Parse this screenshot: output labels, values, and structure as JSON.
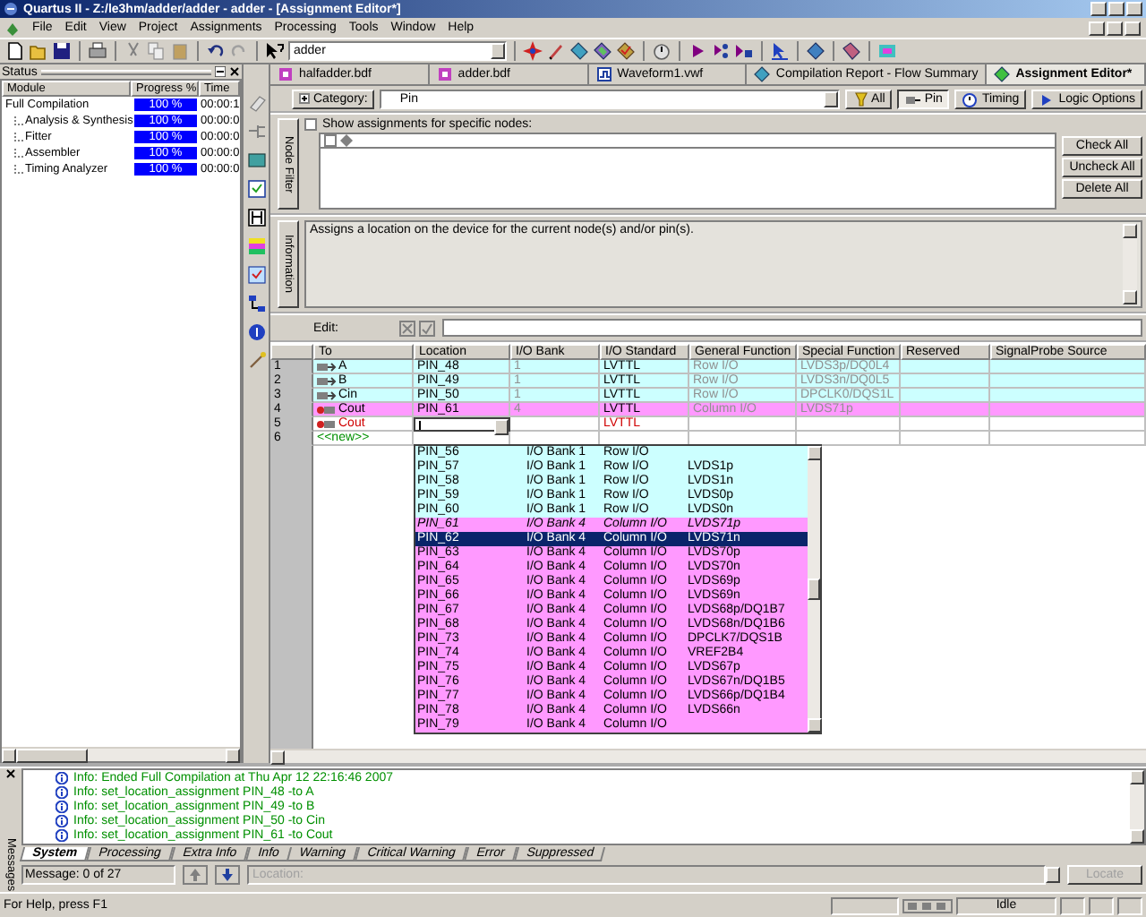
{
  "window": {
    "title": "Quartus II - Z:/le3hm/adder/adder - adder - [Assignment Editor*]"
  },
  "menu": [
    "File",
    "Edit",
    "View",
    "Project",
    "Assignments",
    "Processing",
    "Tools",
    "Window",
    "Help"
  ],
  "toolbar": {
    "project": "adder"
  },
  "status_panel": {
    "title": "Status",
    "columns": [
      "Module",
      "Progress %",
      "Time"
    ],
    "rows": [
      {
        "module": "Full Compilation",
        "level": 1,
        "progress": "100 %",
        "time": "00:00:1",
        "children": [
          {
            "module": "Analysis & Synthesis",
            "level": 1,
            "progress": "100 %",
            "time": "00:00:0"
          },
          {
            "module": "Fitter",
            "level": 1,
            "progress": "100 %",
            "time": "00:00:0"
          },
          {
            "module": "Assembler",
            "level": 1,
            "progress": "100 %",
            "time": "00:00:0"
          },
          {
            "module": "Timing Analyzer",
            "level": 1,
            "progress": "100 %",
            "time": "00:00:0"
          }
        ]
      }
    ]
  },
  "document_tabs": [
    {
      "label": "halfadder.bdf",
      "selected": false
    },
    {
      "label": "adder.bdf",
      "selected": false
    },
    {
      "label": "Waveform1.vwf",
      "selected": false
    },
    {
      "label": "Compilation Report - Flow Summary",
      "selected": false
    },
    {
      "label": "Assignment Editor*",
      "selected": true
    }
  ],
  "category": {
    "label": "Category:",
    "value": "Pin",
    "buttons": [
      {
        "label": "All",
        "selected": false
      },
      {
        "label": "Pin",
        "selected": true
      },
      {
        "label": "Timing",
        "selected": false
      },
      {
        "label": "Logic Options",
        "selected": false
      }
    ]
  },
  "node_filter": {
    "side_label": "Node Filter",
    "checkbox": {
      "label": "Show assignments for specific nodes:",
      "checked": false
    },
    "node_row": {
      "checked": false
    },
    "buttons": [
      "Check All",
      "Uncheck All",
      "Delete All"
    ]
  },
  "information": {
    "side_label": "Information",
    "text": "Assigns a location on the device for the current node(s) and/or pin(s)."
  },
  "edit_bar": {
    "label": "Edit:"
  },
  "table": {
    "columns": [
      "To",
      "Location",
      "I/O Bank",
      "I/O Standard",
      "General Function",
      "Special Function",
      "Reserved",
      "SignalProbe Source"
    ],
    "rows": [
      {
        "kind": "assigned",
        "num": "1",
        "is_output": false,
        "to": "A",
        "location": "PIN_48",
        "io_bank": "1",
        "io_standard": "LVTTL",
        "general_function": "Row I/O",
        "special_function": "LVDS3p/DQ0L4",
        "color": "#ccffff"
      },
      {
        "kind": "assigned",
        "num": "2",
        "is_output": false,
        "to": "B",
        "location": "PIN_49",
        "io_bank": "1",
        "io_standard": "LVTTL",
        "general_function": "Row I/O",
        "special_function": "LVDS3n/DQ0L5",
        "color": "#ccffff"
      },
      {
        "kind": "assigned",
        "num": "3",
        "is_output": false,
        "to": "Cin",
        "location": "PIN_50",
        "io_bank": "1",
        "io_standard": "LVTTL",
        "general_function": "Row I/O",
        "special_function": "DPCLK0/DQS1L",
        "color": "#ccffff"
      },
      {
        "kind": "assigned",
        "num": "4",
        "is_output": true,
        "to": "Cout",
        "location": "PIN_61",
        "io_bank": "4",
        "io_standard": "LVTTL",
        "general_function": "Column I/O",
        "special_function": "LVDS71p",
        "color": "#ff99ff"
      },
      {
        "kind": "editing",
        "num": "5",
        "is_output": true,
        "to": "Cout",
        "io_standard": "LVTTL"
      },
      {
        "kind": "new",
        "num": "6",
        "to": "<<new>>"
      }
    ],
    "dropdown": [
      {
        "location": "PIN_56",
        "io_bank": "I/O Bank 1",
        "general_function": "Row I/O",
        "color": "#ccffff",
        "selected": false,
        "assigned": false
      },
      {
        "location": "PIN_57",
        "io_bank": "I/O Bank 1",
        "general_function": "Row I/O",
        "special_function": "LVDS1p",
        "color": "#ccffff",
        "selected": false,
        "assigned": false
      },
      {
        "location": "PIN_58",
        "io_bank": "I/O Bank 1",
        "general_function": "Row I/O",
        "special_function": "LVDS1n",
        "color": "#ccffff",
        "selected": false,
        "assigned": false
      },
      {
        "location": "PIN_59",
        "io_bank": "I/O Bank 1",
        "general_function": "Row I/O",
        "special_function": "LVDS0p",
        "color": "#ccffff",
        "selected": false,
        "assigned": false
      },
      {
        "location": "PIN_60",
        "io_bank": "I/O Bank 1",
        "general_function": "Row I/O",
        "special_function": "LVDS0n",
        "color": "#ccffff",
        "selected": false,
        "assigned": false
      },
      {
        "location": "PIN_61",
        "io_bank": "I/O Bank 4",
        "general_function": "Column I/O",
        "special_function": "LVDS71p",
        "color": "#ff99ff",
        "selected": false,
        "assigned": true
      },
      {
        "location": "PIN_62",
        "io_bank": "I/O Bank 4",
        "general_function": "Column I/O",
        "special_function": "LVDS71n",
        "selected": true,
        "assigned": false
      },
      {
        "location": "PIN_63",
        "io_bank": "I/O Bank 4",
        "general_function": "Column I/O",
        "special_function": "LVDS70p",
        "color": "#ff99ff",
        "selected": false,
        "assigned": false
      },
      {
        "location": "PIN_64",
        "io_bank": "I/O Bank 4",
        "general_function": "Column I/O",
        "special_function": "LVDS70n",
        "color": "#ff99ff",
        "selected": false,
        "assigned": false
      },
      {
        "location": "PIN_65",
        "io_bank": "I/O Bank 4",
        "general_function": "Column I/O",
        "special_function": "LVDS69p",
        "color": "#ff99ff",
        "selected": false,
        "assigned": false
      },
      {
        "location": "PIN_66",
        "io_bank": "I/O Bank 4",
        "general_function": "Column I/O",
        "special_function": "LVDS69n",
        "color": "#ff99ff",
        "selected": false,
        "assigned": false
      },
      {
        "location": "PIN_67",
        "io_bank": "I/O Bank 4",
        "general_function": "Column I/O",
        "special_function": "LVDS68p/DQ1B7",
        "color": "#ff99ff",
        "selected": false,
        "assigned": false
      },
      {
        "location": "PIN_68",
        "io_bank": "I/O Bank 4",
        "general_function": "Column I/O",
        "special_function": "LVDS68n/DQ1B6",
        "color": "#ff99ff",
        "selected": false,
        "assigned": false
      },
      {
        "location": "PIN_73",
        "io_bank": "I/O Bank 4",
        "general_function": "Column I/O",
        "special_function": "DPCLK7/DQS1B",
        "color": "#ff99ff",
        "selected": false,
        "assigned": false
      },
      {
        "location": "PIN_74",
        "io_bank": "I/O Bank 4",
        "general_function": "Column I/O",
        "special_function": "VREF2B4",
        "color": "#ff99ff",
        "selected": false,
        "assigned": false
      },
      {
        "location": "PIN_75",
        "io_bank": "I/O Bank 4",
        "general_function": "Column I/O",
        "special_function": "LVDS67p",
        "color": "#ff99ff",
        "selected": false,
        "assigned": false
      },
      {
        "location": "PIN_76",
        "io_bank": "I/O Bank 4",
        "general_function": "Column I/O",
        "special_function": "LVDS67n/DQ1B5",
        "color": "#ff99ff",
        "selected": false,
        "assigned": false
      },
      {
        "location": "PIN_77",
        "io_bank": "I/O Bank 4",
        "general_function": "Column I/O",
        "special_function": "LVDS66p/DQ1B4",
        "color": "#ff99ff",
        "selected": false,
        "assigned": false
      },
      {
        "location": "PIN_78",
        "io_bank": "I/O Bank 4",
        "general_function": "Column I/O",
        "special_function": "LVDS66n",
        "color": "#ff99ff",
        "selected": false,
        "assigned": false
      },
      {
        "location": "PIN_79",
        "io_bank": "I/O Bank 4",
        "general_function": "Column I/O",
        "color": "#ff99ff",
        "selected": false,
        "assigned": false
      }
    ]
  },
  "messages": {
    "side_label": "Messages",
    "lines": [
      "Info: Ended Full Compilation at Thu Apr 12 22:16:46 2007",
      "Info: set_location_assignment PIN_48 -to A",
      "Info: set_location_assignment PIN_49 -to B",
      "Info: set_location_assignment PIN_50 -to Cin",
      "Info: set_location_assignment PIN_61 -to Cout"
    ],
    "tabs": [
      {
        "label": "System",
        "selected": true
      },
      {
        "label": "Processing",
        "selected": false
      },
      {
        "label": "Extra Info",
        "selected": false
      },
      {
        "label": "Info",
        "selected": false
      },
      {
        "label": "Warning",
        "selected": false
      },
      {
        "label": "Critical Warning",
        "selected": false
      },
      {
        "label": "Error",
        "selected": false
      },
      {
        "label": "Suppressed",
        "selected": false
      }
    ],
    "counter": "Message: 0 of 27",
    "location": {
      "placeholder": "Location:"
    },
    "locate_button": {
      "label": "Locate",
      "disabled": true
    }
  },
  "status_bar": {
    "help": "For Help, press F1",
    "state": "Idle"
  }
}
